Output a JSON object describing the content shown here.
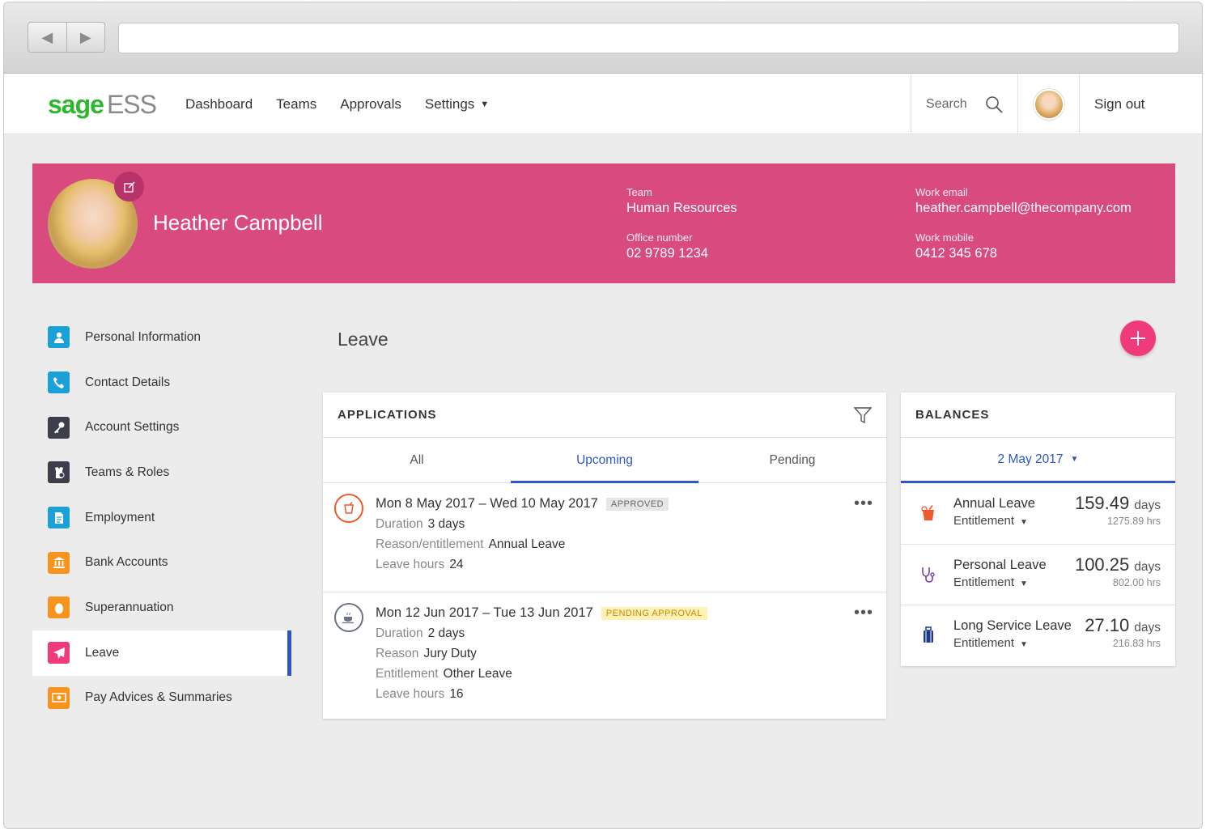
{
  "app": {
    "logo_sage": "sage",
    "logo_ess": "ESS"
  },
  "nav": {
    "items": [
      "Dashboard",
      "Teams",
      "Approvals",
      "Settings"
    ],
    "search_label": "Search",
    "signout_label": "Sign out"
  },
  "profile": {
    "name": "Heather Campbell",
    "team_label": "Team",
    "team": "Human Resources",
    "office_label": "Office number",
    "office": "02 9789 1234",
    "email_label": "Work email",
    "email": "heather.campbell@thecompany.com",
    "mobile_label": "Work mobile",
    "mobile": "0412 345 678"
  },
  "sidebar": {
    "items": [
      {
        "label": "Personal Information",
        "icon": "person-icon",
        "color": "#1ba1d8"
      },
      {
        "label": "Contact Details",
        "icon": "phone-icon",
        "color": "#1ba1d8"
      },
      {
        "label": "Account Settings",
        "icon": "key-icon",
        "color": "#3c3f4b"
      },
      {
        "label": "Teams & Roles",
        "icon": "badge-icon",
        "color": "#3c3f4b"
      },
      {
        "label": "Employment",
        "icon": "document-icon",
        "color": "#1ba1d8"
      },
      {
        "label": "Bank Accounts",
        "icon": "bank-icon",
        "color": "#f7941d"
      },
      {
        "label": "Superannuation",
        "icon": "egg-icon",
        "color": "#f7941d"
      },
      {
        "label": "Leave",
        "icon": "plane-icon",
        "color": "#ef3b7c"
      },
      {
        "label": "Pay Advices & Summaries",
        "icon": "money-icon",
        "color": "#f7941d"
      }
    ],
    "active": "Leave"
  },
  "leave": {
    "title": "Leave",
    "applications": {
      "header": "APPLICATIONS",
      "tabs": [
        "All",
        "Upcoming",
        "Pending"
      ],
      "active_tab": "Upcoming",
      "items": [
        {
          "dates": "Mon 8 May 2017 – Wed 10 May 2017",
          "status": "APPROVED",
          "duration_label": "Duration",
          "duration": "3 days",
          "reason_label": "Reason/entitlement",
          "reason": "Annual Leave",
          "hours_label": "Leave hours",
          "hours": "24"
        },
        {
          "dates": "Mon 12 Jun 2017 – Tue 13 Jun 2017",
          "status": "PENDING APPROVAL",
          "duration_label": "Duration",
          "duration": "2 days",
          "reason_label": "Reason",
          "reason": "Jury Duty",
          "entitlement_label": "Entitlement",
          "entitlement": "Other Leave",
          "hours_label": "Leave hours",
          "hours": "16"
        }
      ]
    },
    "balances": {
      "header": "BALANCES",
      "date": "2 May 2017",
      "items": [
        {
          "name": "Annual Leave",
          "entitlement": "Entitlement",
          "days": "159.49",
          "unit": "days",
          "hours": "1275.89 hrs"
        },
        {
          "name": "Personal Leave",
          "entitlement": "Entitlement",
          "days": "100.25",
          "unit": "days",
          "hours": "802.00 hrs"
        },
        {
          "name": "Long Service Leave",
          "entitlement": "Entitlement",
          "days": "27.10",
          "unit": "days",
          "hours": "216.83 hrs"
        }
      ]
    }
  },
  "colors": {
    "banner": "#d94a7e",
    "accent": "#2d56c4",
    "fab": "#ef3b7c",
    "logo_green": "#2fb82e"
  }
}
